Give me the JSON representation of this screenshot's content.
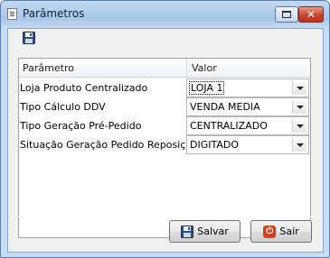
{
  "window": {
    "title": "Parâmetros",
    "close_glyph": "✕"
  },
  "toolbar": {
    "save_icon": "floppy-disk-icon"
  },
  "grid": {
    "columns": [
      "Parâmetro",
      "Valor"
    ],
    "rows": [
      {
        "label": "Loja Produto Centralizado",
        "value": "LOJA 1"
      },
      {
        "label": "Tipo Cálculo DDV",
        "value": "VENDA MEDIA"
      },
      {
        "label": "Tipo Geração Pré-Pedido",
        "value": "CENTRALIZADO"
      },
      {
        "label": "Situação Geração Pedido Reposição",
        "value": "DIGITADO"
      }
    ]
  },
  "buttons": {
    "save_label": "Salvar",
    "exit_label": "Sair",
    "exit_glyph": "⏻"
  }
}
